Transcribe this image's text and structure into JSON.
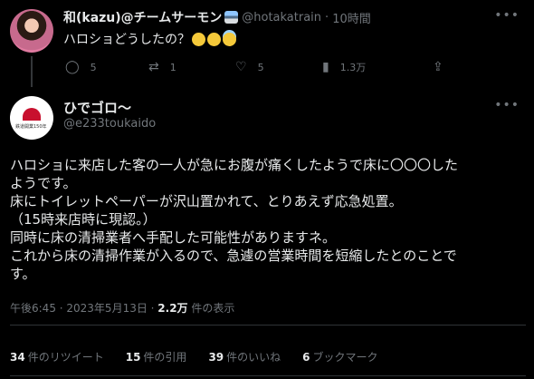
{
  "reply": {
    "author_name": "和(kazu)@チームサーモン",
    "handle": "@hotakatrain",
    "separator": "·",
    "time_ago": "10時間",
    "text": "ハロショどうしたの？",
    "actions": {
      "reply_count": "5",
      "retweet_count": "1",
      "like_count": "5",
      "view_count": "1.3万"
    }
  },
  "tweet": {
    "author_name": "ひでゴロ〜",
    "handle": "@e233toukaido",
    "body_lines": [
      "ハロショに来店した客の一人が急にお腹が痛くしたようで床に〇〇〇した",
      "ようです。",
      "床にトイレットペーパーが沢山置かれて、とりあえず応急処置。",
      "（15時来店時に現認。）",
      "同時に床の清掃業者へ手配した可能性がありますネ。",
      "これから床の清掃作業が入るので、急遽の営業時間を短縮したとのことで",
      "す。"
    ],
    "timestamp": "午後6:45 · 2023年5月13日 · ",
    "views_value": "2.2万",
    "views_label": " 件の表示",
    "avatar_logo_text": "鉄道開業150年"
  },
  "stats": {
    "retweets_value": "34",
    "retweets_label": "件のリツイート",
    "quotes_value": "15",
    "quotes_label": "件の引用",
    "likes_value": "39",
    "likes_label": "件のいいね",
    "bookmarks_value": "6",
    "bookmarks_label": "ブックマーク"
  },
  "icons": {
    "more": "more-icon",
    "reply": "reply-icon",
    "retweet": "retweet-icon",
    "like": "heart-icon",
    "views": "views-icon",
    "share": "share-icon"
  },
  "colors": {
    "background": "#000000",
    "text": "#e7e9ea",
    "muted": "#71767b",
    "divider": "#2f3336"
  }
}
